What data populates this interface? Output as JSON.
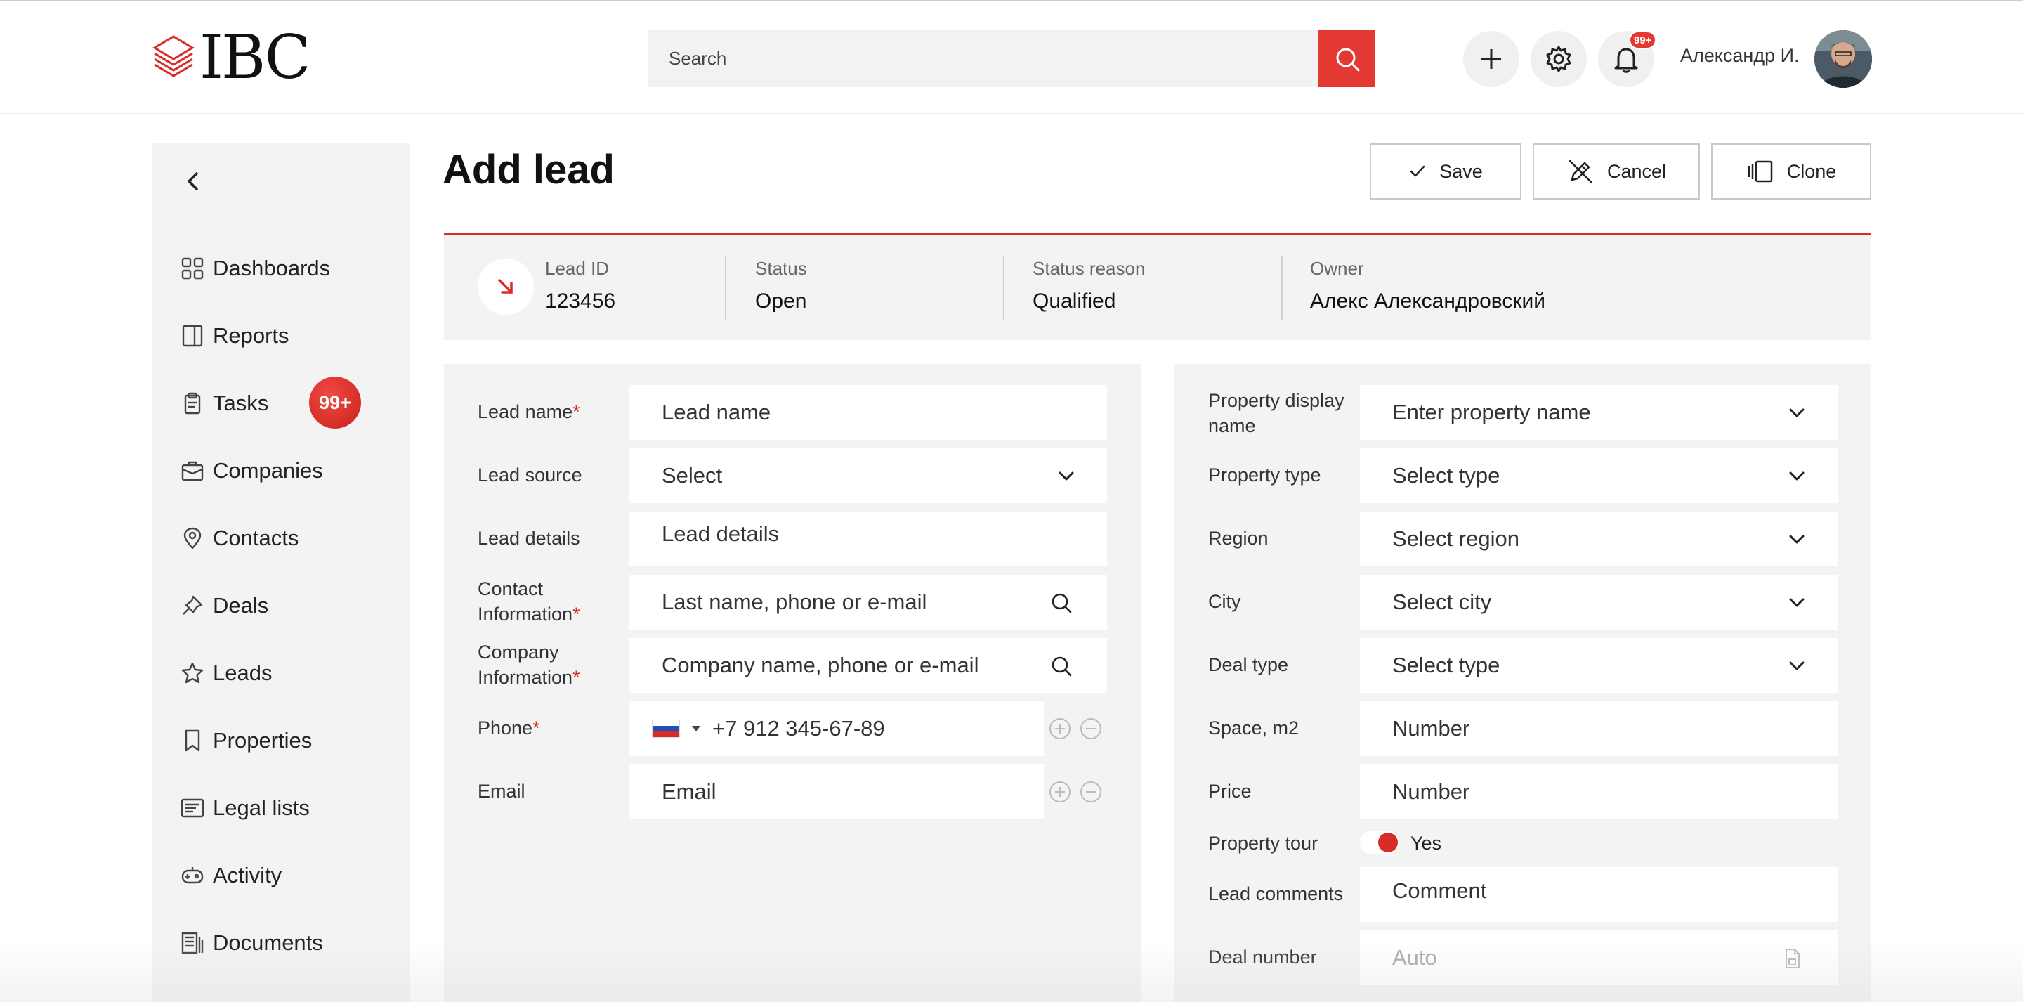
{
  "brand": {
    "logo_text": "IBC",
    "accent_color": "#e23a33"
  },
  "header": {
    "search_placeholder": "Search",
    "search_icon": "search-icon",
    "add_icon": "plus-icon",
    "settings_icon": "gear-icon",
    "notifications_icon": "bell-icon",
    "notifications_badge": "99+",
    "user_name": "Александр И."
  },
  "sidebar": {
    "back_icon": "chevron-left-icon",
    "items": [
      {
        "label": "Dashboards",
        "icon": "grid-icon"
      },
      {
        "label": "Reports",
        "icon": "report-icon"
      },
      {
        "label": "Tasks",
        "icon": "clipboard-icon",
        "badge": "99+"
      },
      {
        "label": "Companies",
        "icon": "briefcase-icon"
      },
      {
        "label": "Contacts",
        "icon": "location-pin-icon"
      },
      {
        "label": "Deals",
        "icon": "pin-icon"
      },
      {
        "label": "Leads",
        "icon": "star-icon"
      },
      {
        "label": "Properties",
        "icon": "bookmark-icon"
      },
      {
        "label": "Legal lists",
        "icon": "list-card-icon"
      },
      {
        "label": "Activity",
        "icon": "gamepad-icon"
      },
      {
        "label": "Documents",
        "icon": "documents-icon"
      }
    ]
  },
  "page": {
    "title": "Add lead",
    "actions": {
      "save": "Save",
      "cancel": "Cancel",
      "clone": "Clone"
    }
  },
  "summary": {
    "lead_id_label": "Lead ID",
    "lead_id": "123456",
    "status_label": "Status",
    "status": "Open",
    "status_reason_label": "Status reason",
    "status_reason": "Qualified",
    "owner_label": "Owner",
    "owner": "Алекс Александровский"
  },
  "left_form": {
    "lead_name": {
      "label": "Lead name",
      "placeholder": "Lead name"
    },
    "lead_source": {
      "label": "Lead source",
      "value": "Select"
    },
    "lead_details": {
      "label": "Lead details",
      "placeholder": "Lead details"
    },
    "contact": {
      "label_1": "Contact",
      "label_2": "Information",
      "placeholder": "Last name, phone or e-mail"
    },
    "company": {
      "label_1": "Company",
      "label_2": "Information",
      "placeholder": "Company name, phone or e-mail"
    },
    "phone": {
      "label": "Phone",
      "placeholder": "+7 912 345-67-89"
    },
    "email": {
      "label": "Email",
      "placeholder": "Email"
    }
  },
  "right_form": {
    "property_display": {
      "label_1": "Property display",
      "label_2": "name",
      "value": "Enter property name"
    },
    "property_type": {
      "label": "Property type",
      "value": "Select type"
    },
    "region": {
      "label": "Region",
      "value": "Select region"
    },
    "city": {
      "label": "City",
      "value": "Select city"
    },
    "deal_type": {
      "label": "Deal type",
      "value": "Select type"
    },
    "space": {
      "label": "Space, m2",
      "placeholder": "Number"
    },
    "price": {
      "label": "Price",
      "placeholder": "Number"
    },
    "property_tour": {
      "label": "Property tour",
      "value": "Yes",
      "on": true
    },
    "lead_comments": {
      "label": "Lead comments",
      "placeholder": "Comment"
    },
    "deal_number": {
      "label": "Deal number",
      "value": "Auto"
    }
  }
}
